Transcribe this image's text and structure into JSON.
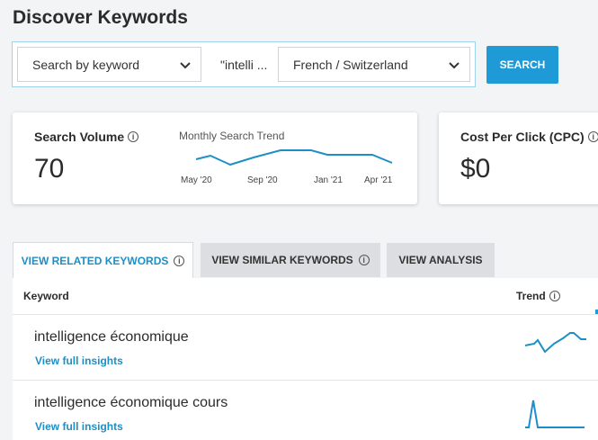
{
  "page": {
    "title": "Discover Keywords"
  },
  "search": {
    "type_select": "Search by keyword",
    "keyword_value": "\"intelli ...",
    "location_select": "French / Switzerland",
    "button_label": "SEARCH"
  },
  "volume_card": {
    "label": "Search Volume",
    "value": "70",
    "trend_title": "Monthly Search Trend",
    "ticks": [
      "May '20",
      "Sep '20",
      "Jan '21",
      "Apr '21"
    ]
  },
  "cpc_card": {
    "label": "Cost Per Click (CPC)",
    "value": "$0"
  },
  "tabs": [
    {
      "label": "VIEW RELATED KEYWORDS",
      "active": true
    },
    {
      "label": "VIEW SIMILAR KEYWORDS",
      "active": false
    },
    {
      "label": "VIEW ANALYSIS",
      "active": false
    }
  ],
  "table": {
    "headers": {
      "keyword": "Keyword",
      "trend": "Trend"
    },
    "rows": [
      {
        "keyword": "intelligence économique",
        "link": "View full insights"
      },
      {
        "keyword": "intelligence économique cours",
        "link": "View full insights"
      }
    ]
  },
  "colors": {
    "accent": "#1e9bd7",
    "link": "#1e8fc6"
  }
}
